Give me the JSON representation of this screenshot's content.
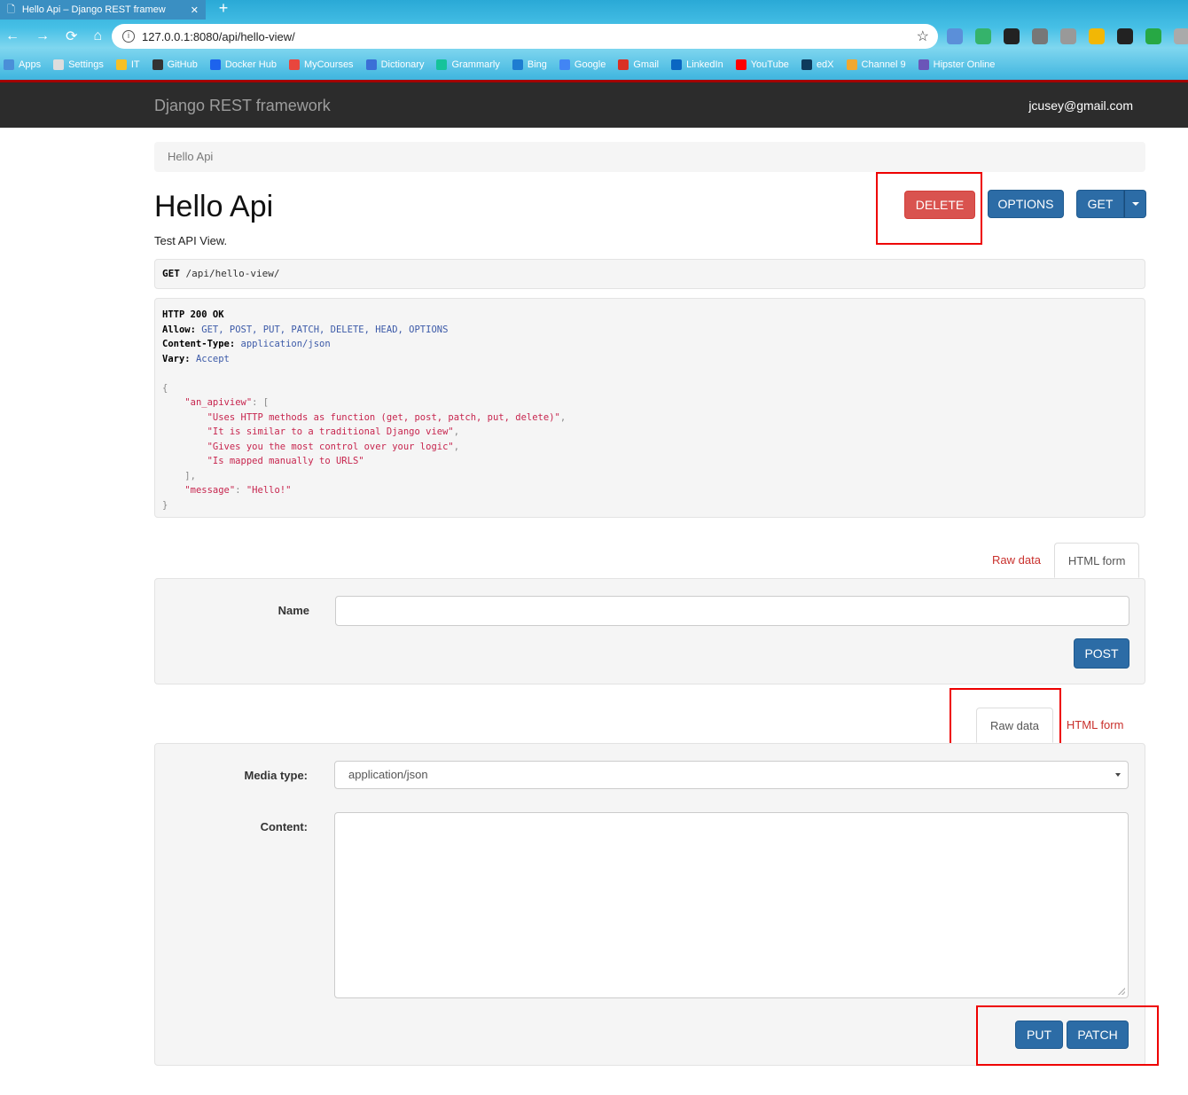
{
  "browser": {
    "tab_title": "Hello Api – Django REST framew",
    "tab_close": "✕",
    "new_tab": "+",
    "url": "127.0.0.1:8080/api/hello-view/",
    "bookmarks": [
      "Apps",
      "Settings",
      "IT",
      "GitHub",
      "Docker Hub",
      "MyCourses",
      "Dictionary",
      "Grammarly",
      "Bing",
      "Google",
      "Gmail",
      "LinkedIn",
      "YouTube",
      "edX",
      "Channel 9",
      "Hipster Online"
    ],
    "bookmark_colors": [
      "#4a8fd8",
      "#ddd",
      "#f6c026",
      "#333",
      "#1d63ed",
      "#e8463d",
      "#3b6fd6",
      "#15c39a",
      "#1e7dd1",
      "#4285f4",
      "#d93025",
      "#0a66c2",
      "#ff0000",
      "#0e3b5c",
      "#f0a830",
      "#6b56b8"
    ],
    "extension_colors": [
      "#5b8fd9",
      "#35b36b",
      "#222",
      "#777",
      "#999",
      "#f2b705",
      "#222",
      "#27a844",
      "#aaa"
    ]
  },
  "navbar": {
    "brand": "Django REST framework",
    "user": "jcusey@gmail.com"
  },
  "breadcrumb": "Hello Api",
  "page": {
    "title": "Hello Api",
    "description": "Test API View."
  },
  "actions": {
    "delete": "DELETE",
    "options": "OPTIONS",
    "get": "GET"
  },
  "request": {
    "method": "GET",
    "path": "/api/hello-view/"
  },
  "response": {
    "status": "HTTP 200 OK",
    "headers": [
      {
        "key": "Allow",
        "value": "GET, POST, PUT, PATCH, DELETE, HEAD, OPTIONS"
      },
      {
        "key": "Content-Type",
        "value": "application/json"
      },
      {
        "key": "Vary",
        "value": "Accept"
      }
    ],
    "list_key": "\"an_apiview\"",
    "list_items": [
      "\"Uses HTTP methods as function (get, post, patch, put, delete)\"",
      "\"It is similar to a traditional Django view\"",
      "\"Gives you the most control over your logic\"",
      "\"Is mapped manually to URLS\""
    ],
    "message_key": "\"message\"",
    "message_value": "\"Hello!\""
  },
  "post_form": {
    "tabs": [
      "Raw data",
      "HTML form"
    ],
    "active_tab": "HTML form",
    "name_label": "Name",
    "name_value": "",
    "submit": "POST"
  },
  "raw_form": {
    "tabs": [
      "Raw data",
      "HTML form"
    ],
    "active_tab": "Raw data",
    "media_type_label": "Media type:",
    "media_type_value": "application/json",
    "content_label": "Content:",
    "content_value": "",
    "put": "PUT",
    "patch": "PATCH"
  },
  "colors": {
    "danger": "#d9534f",
    "primary": "#2c6ca6",
    "highlight": "#ee0000",
    "navbar": "#2c2c2c"
  }
}
